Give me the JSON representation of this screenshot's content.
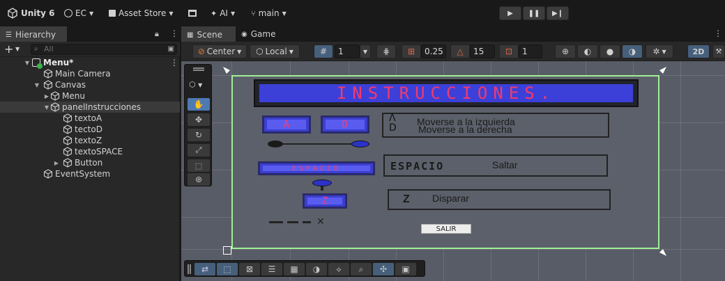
{
  "topbar": {
    "app_title": "Unity 6",
    "account": "EC",
    "asset_store": "Asset Store",
    "ai": "AI",
    "branch": "main"
  },
  "hierarchy": {
    "tab_label": "Hierarchy",
    "search_placeholder": "All",
    "scene_name": "Menu*",
    "items": [
      {
        "label": "Main Camera"
      },
      {
        "label": "Canvas"
      },
      {
        "label": "Menu"
      },
      {
        "label": "panelInstrucciones"
      },
      {
        "label": "textoA"
      },
      {
        "label": "tectoD"
      },
      {
        "label": "textoZ"
      },
      {
        "label": "textoSPACE"
      },
      {
        "label": "Button"
      },
      {
        "label": "EventSystem"
      }
    ]
  },
  "scene": {
    "tabs": [
      {
        "label": "Scene"
      },
      {
        "label": "Game"
      }
    ],
    "pivot_mode": "Center",
    "space_mode": "Local",
    "grid_size": "1",
    "snap_value": "0.25",
    "rotate_snap": "15",
    "scale_snap": "1",
    "view_2d": "2D"
  },
  "canvas_ui": {
    "title": "INSTRUCCIONES.",
    "key_a": "A",
    "key_d": "D",
    "move_left": "Moverse a la izquierda",
    "move_right": "Moverse a la derecha",
    "key_space": "ESPACIO",
    "space_box_label": "ESPACIO",
    "jump": "Saltar",
    "key_z": "Z",
    "z_box_label": "Z",
    "shoot": "Disparar",
    "exit_button": "SALIR"
  },
  "colors": {
    "selection_green": "#9ff095",
    "accent_blue": "#4e7ab4",
    "key_blue": "#3b3fd0"
  }
}
